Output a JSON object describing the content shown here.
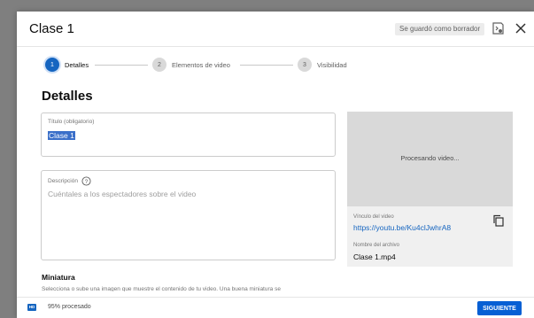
{
  "dialog": {
    "title": "Clase 1",
    "draft_status": "Se guardó como borrador",
    "icons": {
      "feedback": "feedback-icon",
      "close": "close-icon"
    }
  },
  "stepper": {
    "steps": [
      {
        "number": "1",
        "label": "Detalles",
        "active": true
      },
      {
        "number": "2",
        "label": "Elementos de video",
        "active": false
      },
      {
        "number": "3",
        "label": "Visibilidad",
        "active": false
      }
    ]
  },
  "details": {
    "heading": "Detalles",
    "title_field": {
      "label": "Título (obligatorio)",
      "value": "Clase 1"
    },
    "description_field": {
      "label": "Descripción",
      "placeholder": "Cuéntales a los espectadores sobre el video"
    },
    "thumbnail": {
      "heading": "Miniatura",
      "description": "Selecciona o sube una imagen que muestre el contenido de tu video. Una buena miniatura se"
    }
  },
  "preview": {
    "status": "Procesando video...",
    "link_label": "Vínculo del video",
    "link": "https://youtu.be/Ku4clJwhrA8",
    "filename_label": "Nombre del archivo",
    "filename": "Clase 1.mp4"
  },
  "footer": {
    "quality_badge": "HD",
    "progress_text": "95% procesado",
    "progress_percent": 95,
    "next_label": "SIGUIENTE"
  },
  "colors": {
    "accent": "#065fd4",
    "step_active": "#1565c0",
    "overlay": "#7f7f7f"
  }
}
